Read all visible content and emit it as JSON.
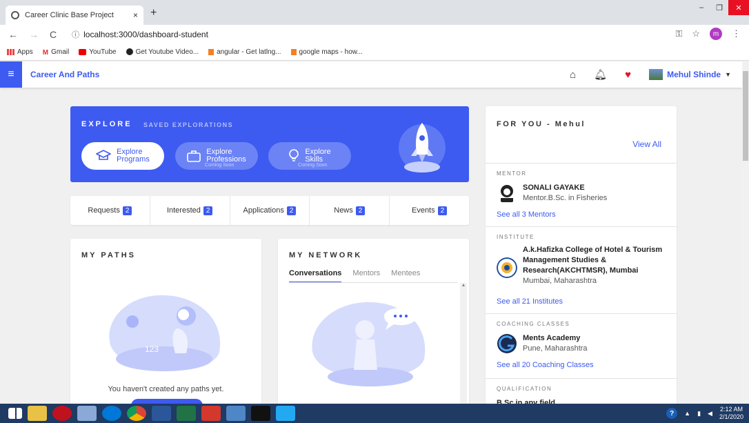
{
  "browser": {
    "tab_title": "Career Clinic Base Project",
    "tab_close": "×",
    "new_tab": "+",
    "url": "localhost:3000/dashboard-student",
    "profile_letter": "m",
    "bookmarks": [
      "Apps",
      "Gmail",
      "YouTube",
      "Get Youtube Video...",
      "angular - Get latlng...",
      "google maps - how..."
    ]
  },
  "header": {
    "brand": "Career And Paths",
    "user_name": "Mehul Shinde"
  },
  "explore": {
    "title": "EXPLORE",
    "saved": "SAVED EXPLORATIONS",
    "pills": [
      {
        "line1": "Explore",
        "line2": "Programs",
        "soon": ""
      },
      {
        "line1": "Explore",
        "line2": "Professions",
        "soon": "Coming Soon"
      },
      {
        "line1": "Explore",
        "line2": "Skills",
        "soon": "Coming Soon"
      }
    ]
  },
  "stats": [
    {
      "label": "Requests",
      "count": "2"
    },
    {
      "label": "Interested",
      "count": "2"
    },
    {
      "label": "Applications",
      "count": "2"
    },
    {
      "label": "News",
      "count": "2"
    },
    {
      "label": "Events",
      "count": "2"
    }
  ],
  "my_paths": {
    "title": "MY PATHS",
    "empty": "You haven't created any paths yet."
  },
  "my_network": {
    "title": "MY NETWORK",
    "tabs": [
      "Conversations",
      "Mentors",
      "Mentees"
    ]
  },
  "for_you": {
    "title": "FOR YOU - Mehul",
    "view_all": "View All",
    "mentor": {
      "label": "MENTOR",
      "name": "SONALI GAYAKE",
      "sub": "Mentor.B.Sc. in Fisheries",
      "link": "See all 3 Mentors"
    },
    "institute": {
      "label": "INSTITUTE",
      "name": "A.k.Hafizka College of Hotel & Tourism Management Studies & Research(AKCHTMSR), Mumbai",
      "sub": "Mumbai, Maharashtra",
      "link": "See all 21 Institutes"
    },
    "coaching": {
      "label": "COACHING CLASSES",
      "name": "Ments Academy",
      "sub": "Pune, Maharashtra",
      "link": "See all 20 Coaching Classes"
    },
    "qualification": {
      "label": "QUALIFICATION",
      "name": "B.Sc in any field"
    }
  },
  "taskbar": {
    "time": "2:12 AM",
    "date": "2/1/2020"
  },
  "colors": {
    "accent": "#3d5af1",
    "heart": "#e0132a"
  }
}
